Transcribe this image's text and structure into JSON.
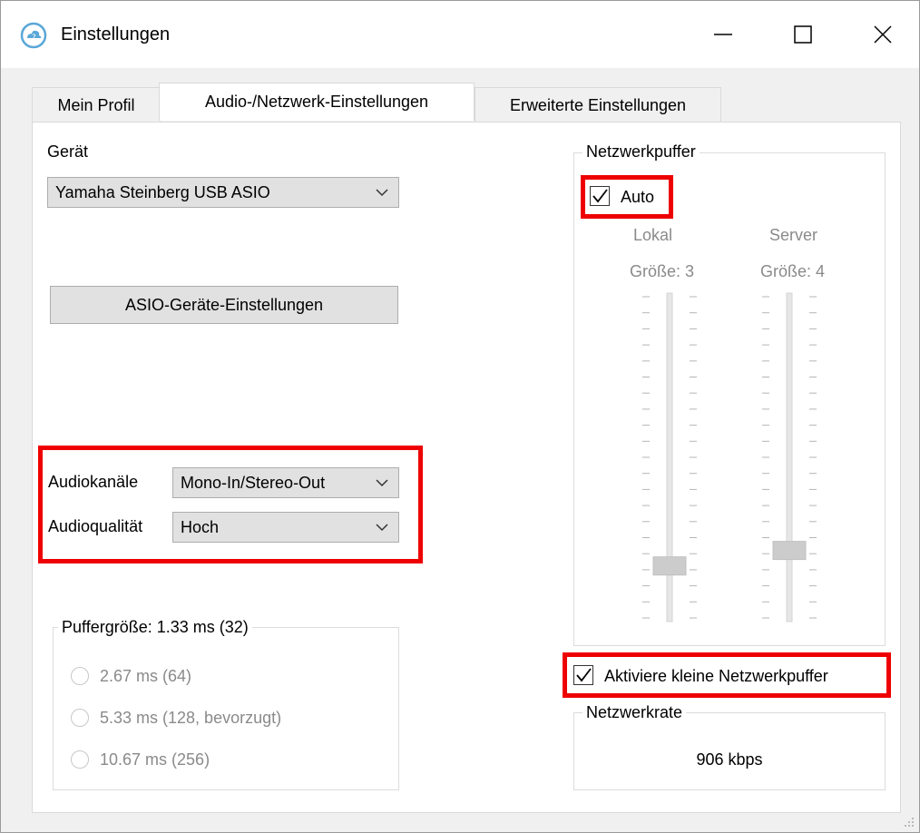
{
  "window": {
    "title": "Einstellungen"
  },
  "tabs": [
    {
      "label": "Mein Profil"
    },
    {
      "label": "Audio-/Netzwerk-Einstellungen"
    },
    {
      "label": "Erweiterte Einstellungen"
    }
  ],
  "device": {
    "label": "Gerät",
    "selected": "Yamaha Steinberg USB ASIO",
    "asio_button": "ASIO-Geräte-Einstellungen"
  },
  "audio_channels": {
    "label": "Audiokanäle",
    "selected": "Mono-In/Stereo-Out"
  },
  "audio_quality": {
    "label": "Audioqualität",
    "selected": "Hoch"
  },
  "buffer_size": {
    "title": "Puffergröße: 1.33 ms (32)",
    "options": [
      {
        "label": "2.67 ms (64)"
      },
      {
        "label": "5.33 ms (128, bevorzugt)"
      },
      {
        "label": "10.67 ms (256)"
      }
    ]
  },
  "network_buffer": {
    "title": "Netzwerkpuffer",
    "auto_label": "Auto",
    "auto_checked": true,
    "local": {
      "label": "Lokal",
      "size": "Größe: 3",
      "value": 3
    },
    "server": {
      "label": "Server",
      "size": "Größe: 4",
      "value": 4
    },
    "slider_max": 20
  },
  "small_buffers": {
    "label": "Aktiviere kleine Netzwerkpuffer",
    "checked": true
  },
  "network_rate": {
    "title": "Netzwerkrate",
    "value": "906 kbps"
  },
  "colors": {
    "highlight": "#ee0000",
    "panel": "#ffffff",
    "background": "#f0f0f0"
  }
}
